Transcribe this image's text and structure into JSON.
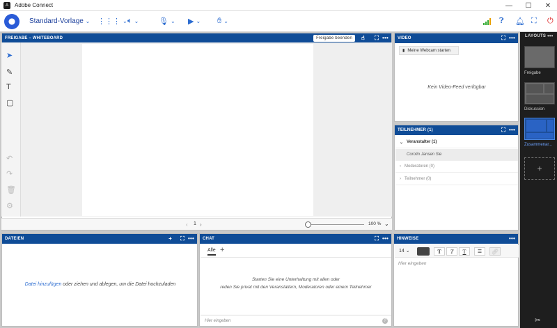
{
  "window": {
    "title": "Adobe Connect"
  },
  "toolbar": {
    "layout_name": "Standard-Vorlage"
  },
  "whiteboard": {
    "title": "FREIGABE – WHITEBOARD",
    "end_share_label": "Freigabe beenden",
    "page_number": "1",
    "zoom": "100 %"
  },
  "video": {
    "title": "VIDEO",
    "webcam_label": "Meine Webcam starten",
    "no_feed": "Kein Video-Feed verfügbar"
  },
  "participants": {
    "title": "TEILNEHMER  (1)",
    "hosts_label": "Veranstalter (1)",
    "host_user": "Corolin Jansen Sie",
    "presenters_label": "Moderatoren (0)",
    "attendees_label": "Teilnehmer (0)"
  },
  "files": {
    "title": "DATEIEN",
    "add_link": "Datei hinzufügen",
    "hint": " oder ziehen und ablegen, um die Datei hochzuladen"
  },
  "chat": {
    "title": "CHAT",
    "tab_all": "Alle",
    "empty_line1": "Starten Sie eine Unterhaltung mit allen oder",
    "empty_line2": "reden Sie privat mit den Veranstaltern, Moderatoren oder einem Teilnehmer",
    "input_placeholder": "Hier eingeben"
  },
  "notes": {
    "title": "HINWEISE",
    "font_size": "14",
    "input_placeholder": "Hier eingeben"
  },
  "layouts": {
    "title": "LAYOUTS",
    "items": [
      {
        "label": "Freigabe"
      },
      {
        "label": "Diskussion"
      },
      {
        "label": "Zusammenar..."
      }
    ]
  },
  "colors": {
    "pod_header": "#0f4c97",
    "accent": "#2a6bd0",
    "sidebar": "#1e1e1e"
  }
}
